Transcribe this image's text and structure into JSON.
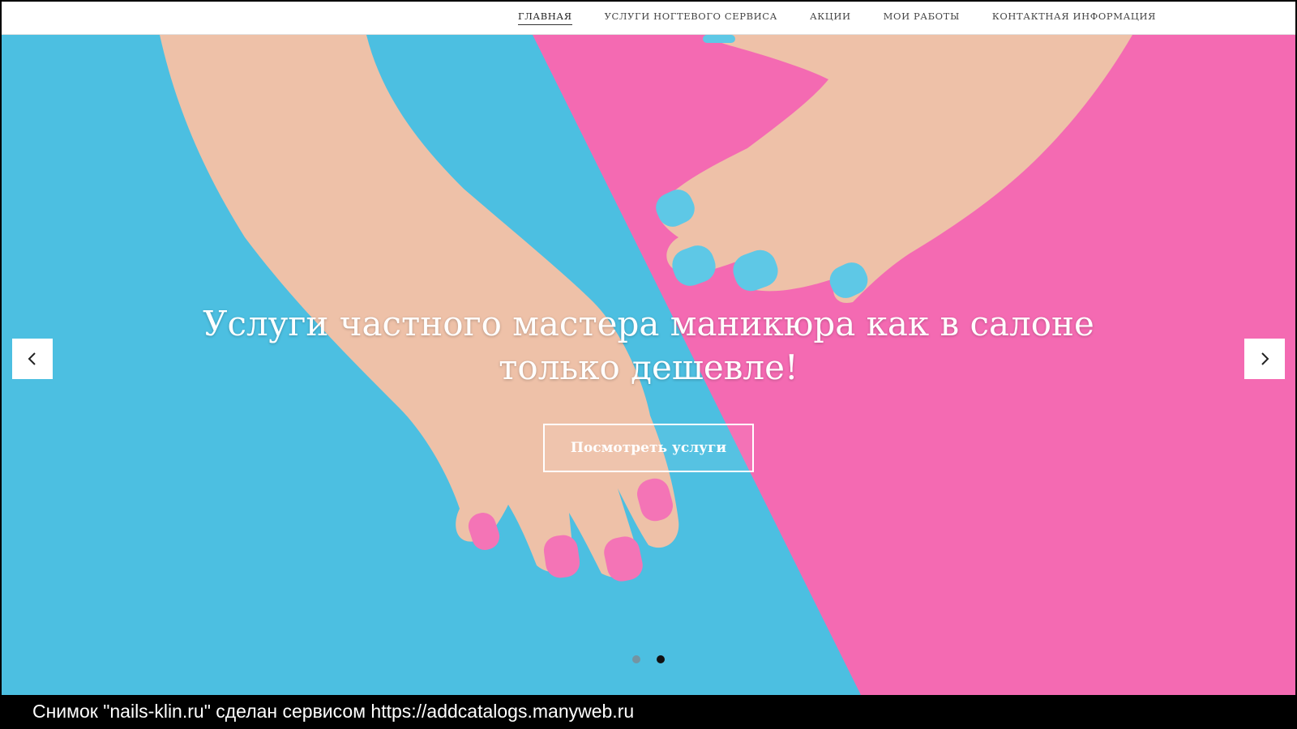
{
  "nav": {
    "items": [
      {
        "label": "Главная",
        "active": true
      },
      {
        "label": "Услуги ногтевого сервиса",
        "active": false
      },
      {
        "label": "Акции",
        "active": false
      },
      {
        "label": "Мои работы",
        "active": false
      },
      {
        "label": "Контактная информация",
        "active": false
      }
    ]
  },
  "hero": {
    "headline_line1": "Услуги частного мастера маникюра как в салоне",
    "headline_line2": "только дешевле!",
    "cta_label": "Посмотреть услуги",
    "prev_icon": "chevron-left-icon",
    "next_icon": "chevron-right-icon",
    "slides_total": 2,
    "active_slide": 2,
    "colors": {
      "blue_background": "#4cbfe1",
      "pink_background": "#f46ab2",
      "nail_blue": "#5ec8e6",
      "nail_pink": "#f474b6",
      "skin": "#eec1a8"
    }
  },
  "footer_caption": {
    "text": "Снимок \"nails-klin.ru\" сделан сервисом https://addcatalogs.manyweb.ru"
  }
}
